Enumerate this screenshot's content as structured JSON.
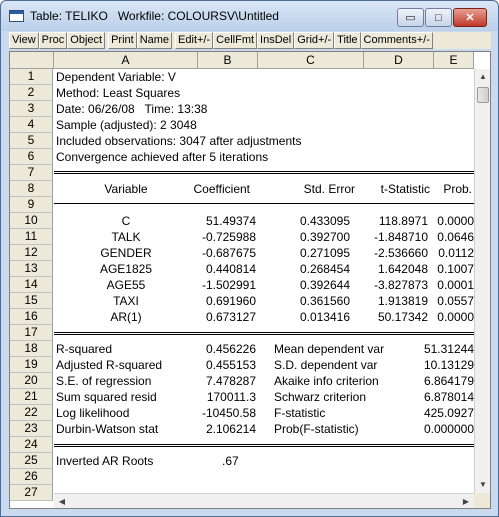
{
  "window": {
    "title": "Table: TELIKO   Workfile: COLOURSV\\Untitled",
    "minimize": "▭",
    "maximize": "□",
    "close": "✕"
  },
  "toolbar": [
    "View",
    "Proc",
    "Object",
    "Print",
    "Name",
    "Edit+/-",
    "CellFmt",
    "InsDel",
    "Grid+/-",
    "Title",
    "Comments+/-"
  ],
  "columns": [
    "A",
    "B",
    "C",
    "D",
    "E"
  ],
  "rows": [
    "1",
    "2",
    "3",
    "4",
    "5",
    "6",
    "7",
    "8",
    "9",
    "10",
    "11",
    "12",
    "13",
    "14",
    "15",
    "16",
    "17",
    "18",
    "19",
    "20",
    "21",
    "22",
    "23",
    "24",
    "25",
    "26",
    "27"
  ],
  "header_lines": [
    "Dependent Variable: V",
    "Method: Least Squares",
    "Date: 06/26/08   Time: 13:38",
    "Sample (adjusted): 2 3048",
    "Included observations: 3047 after adjustments",
    "Convergence achieved after 5 iterations"
  ],
  "coef_header": [
    "Variable",
    "Coefficient",
    "Std. Error",
    "t-Statistic",
    "Prob."
  ],
  "coef_rows": [
    [
      "C",
      "51.49374",
      "0.433095",
      "118.8971",
      "0.0000"
    ],
    [
      "TALK",
      "-0.725988",
      "0.392700",
      "-1.848710",
      "0.0646"
    ],
    [
      "GENDER",
      "-0.687675",
      "0.271095",
      "-2.536660",
      "0.0112"
    ],
    [
      "AGE1825",
      "0.440814",
      "0.268454",
      "1.642048",
      "0.1007"
    ],
    [
      "AGE55",
      "-1.502991",
      "0.392644",
      "-3.827873",
      "0.0001"
    ],
    [
      "TAXI",
      "0.691960",
      "0.361560",
      "1.913819",
      "0.0557"
    ],
    [
      "AR(1)",
      "0.673127",
      "0.013416",
      "50.17342",
      "0.0000"
    ]
  ],
  "stats_rows": [
    [
      "R-squared",
      "0.456226",
      "Mean dependent var",
      "51.31244"
    ],
    [
      "Adjusted R-squared",
      "0.455153",
      "S.D. dependent var",
      "10.13129"
    ],
    [
      "S.E. of regression",
      "7.478287",
      "Akaike info criterion",
      "6.864179"
    ],
    [
      "Sum squared resid",
      "170011.3",
      "Schwarz criterion",
      "6.878014"
    ],
    [
      "Log likelihood",
      "-10450.58",
      "F-statistic",
      "425.0927"
    ],
    [
      "Durbin-Watson stat",
      "2.106214",
      "Prob(F-statistic)",
      "0.000000"
    ]
  ],
  "ar_roots": {
    "label": "Inverted AR Roots",
    "value": ".67"
  }
}
